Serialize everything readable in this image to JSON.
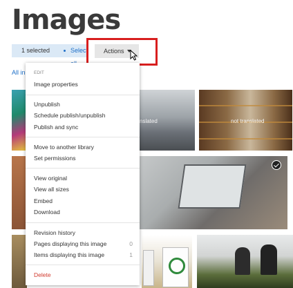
{
  "page": {
    "title": "Images"
  },
  "selection": {
    "count_label": "1 selected",
    "select_all_label": "Select all"
  },
  "toolbar": {
    "actions_label": "Actions"
  },
  "filters": {
    "all_images_link": "All in"
  },
  "tiles": {
    "not_translated_1": "nslated",
    "not_translated_2": "not translated"
  },
  "menu": {
    "edit_header": "EDIT",
    "image_properties": "Image properties",
    "unpublish": "Unpublish",
    "schedule": "Schedule publish/unpublish",
    "publish_sync": "Publish and sync",
    "move_library": "Move to another library",
    "set_permissions": "Set permissions",
    "view_original": "View original",
    "view_all_sizes": "View all sizes",
    "embed": "Embed",
    "download": "Download",
    "revision_history": "Revision history",
    "pages_displaying": "Pages displaying this image",
    "pages_count": "0",
    "items_displaying": "Items displaying this image",
    "items_count": "1",
    "delete": "Delete"
  },
  "colors": {
    "accent": "#1e6fc8",
    "highlight_box": "#d81e1e",
    "delete": "#d03a2e",
    "selection_bg": "#dbe9f6"
  }
}
